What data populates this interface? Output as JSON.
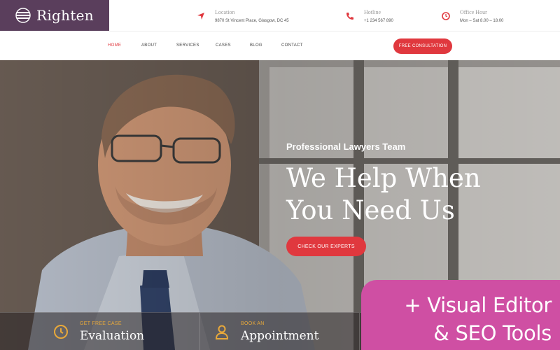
{
  "brand": {
    "name": "Righten"
  },
  "topbar": {
    "location": {
      "label": "Location",
      "value": "9870 St Vincent Place, Glasgow, DC 45"
    },
    "hotline": {
      "label": "Hotline",
      "value": "+1 234 567 890"
    },
    "office": {
      "label": "Office Hour",
      "value": "Mon – Sat 8.00 – 18.00"
    }
  },
  "nav": {
    "items": [
      "HOME",
      "ABOUT",
      "SERVICES",
      "CASES",
      "BLOG",
      "CONTACT"
    ],
    "active": "HOME",
    "cta": "FREE CONSULTATION"
  },
  "hero": {
    "kicker": "Professional Lawyers Team",
    "headline_1": "We Help When",
    "headline_2": "You Need Us",
    "cta": "CHECK OUR EXPERTS"
  },
  "features": [
    {
      "small": "GET FREE CASE",
      "big": "Evaluation",
      "icon": "clock-icon"
    },
    {
      "small": "BOOK AN",
      "big": "Appointment",
      "icon": "user-icon"
    },
    {
      "small": "",
      "big": "",
      "icon": "dollar-icon"
    }
  ],
  "promo": {
    "line_1": "+ Visual Editor",
    "line_2": "& SEO Tools"
  },
  "colors": {
    "accent": "#e0383e",
    "brand": "#5a3e5c",
    "gold": "#e9a93a",
    "promo": "#cf4fa3"
  }
}
